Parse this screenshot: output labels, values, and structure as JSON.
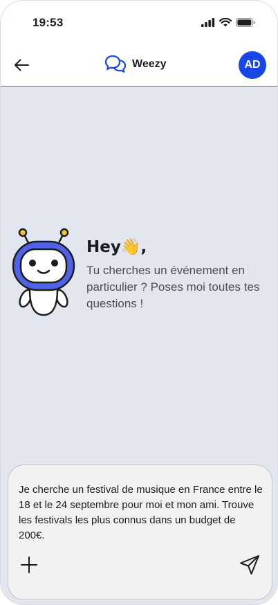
{
  "status_bar": {
    "time": "19:53"
  },
  "header": {
    "brand_name": "Weezy",
    "avatar_initials": "AD"
  },
  "welcome": {
    "greeting": "Hey👋,",
    "subtitle": "Tu cherches un événement en particulier ? Poses moi toutes tes questions !"
  },
  "composer": {
    "message": "Je cherche un festival de musique en France entre le 18 et le 24 septembre pour moi et mon ami. Trouve les festivals les plus connus dans un budget de 200€."
  },
  "colors": {
    "background": "#e2e7ef",
    "accent": "#1746e6",
    "mascot_blue": "#4f63e6",
    "antenna_yellow": "#f4c430"
  },
  "icons": {
    "back": "arrow-left-icon",
    "brand": "chat-bubbles-icon",
    "signal": "signal-icon",
    "wifi": "wifi-icon",
    "battery": "battery-icon",
    "add": "plus-icon",
    "send": "send-icon"
  }
}
